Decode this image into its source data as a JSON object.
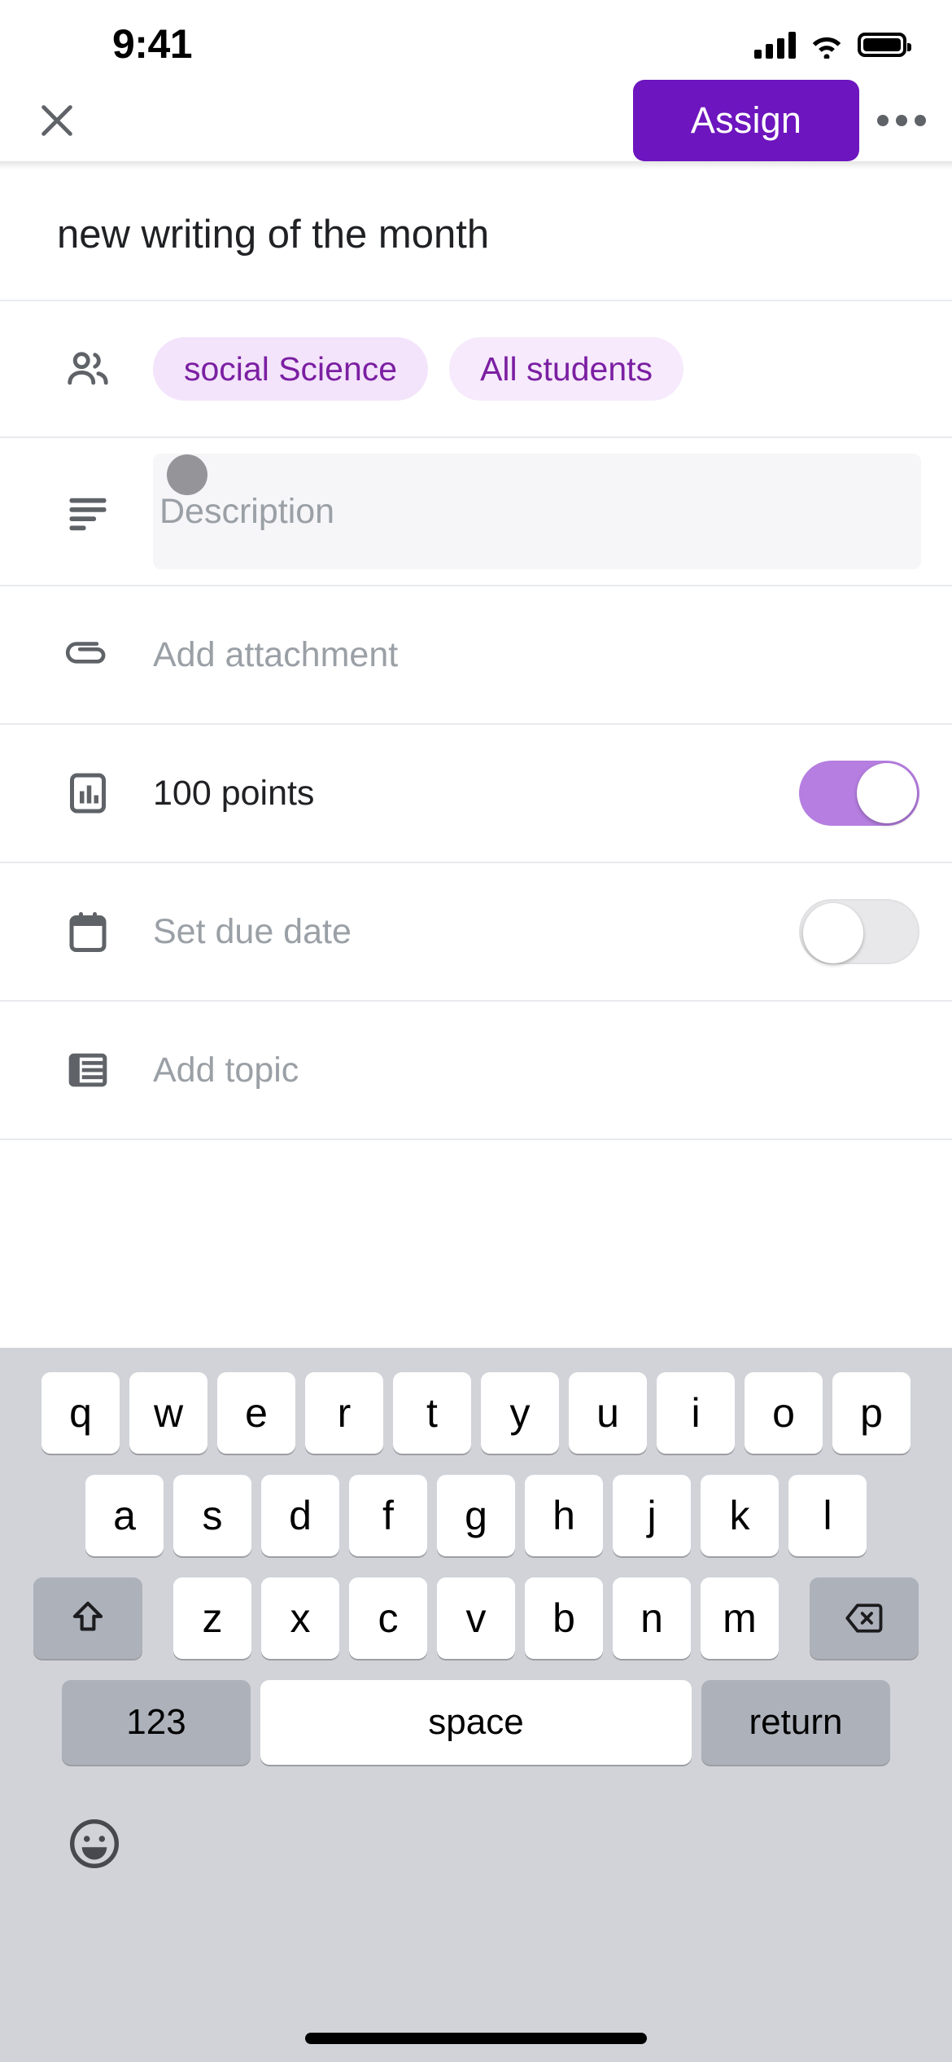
{
  "status_bar": {
    "time": "9:41",
    "signal_icon": "cellular-signal-icon",
    "wifi_icon": "wifi-icon",
    "battery_icon": "battery-icon"
  },
  "appbar": {
    "close_icon": "close-icon",
    "assign_label": "Assign",
    "more_icon": "overflow-menu-icon",
    "assign_color": "#6D15BE"
  },
  "form": {
    "title": "new writing of the month",
    "audience": {
      "icon": "people-icon",
      "chips": [
        {
          "label": "social Science",
          "bg": "#F3E4FB",
          "fg": "#7B1FA2"
        },
        {
          "label": "All students",
          "bg": "#F6EAFC",
          "fg": "#7B1FA2"
        }
      ]
    },
    "description": {
      "icon": "description-lines-icon",
      "placeholder": "Description",
      "value": "",
      "field_bg": "#F6F5F7"
    },
    "attachment": {
      "icon": "paperclip-icon",
      "label": "Add attachment"
    },
    "points": {
      "icon": "bar-chart-icon",
      "label": "100 points",
      "toggle_state": "on",
      "toggle_track_color": "#B57EE0"
    },
    "due_date": {
      "icon": "calendar-icon",
      "label": "Set due date",
      "toggle_state": "off",
      "toggle_track_color": "#E8E8EA"
    },
    "topic": {
      "icon": "list-icon",
      "label": "Add topic"
    }
  },
  "keyboard": {
    "row1": [
      "q",
      "w",
      "e",
      "r",
      "t",
      "y",
      "u",
      "i",
      "o",
      "p"
    ],
    "row2": [
      "a",
      "s",
      "d",
      "f",
      "g",
      "h",
      "j",
      "k",
      "l"
    ],
    "row3": [
      "z",
      "x",
      "c",
      "v",
      "b",
      "n",
      "m"
    ],
    "shift_icon": "shift-arrow-icon",
    "backspace_icon": "backspace-icon",
    "numbers_label": "123",
    "space_label": "space",
    "return_label": "return",
    "emoji_icon": "emoji-smiley-icon",
    "background": "#D1D3D9"
  }
}
